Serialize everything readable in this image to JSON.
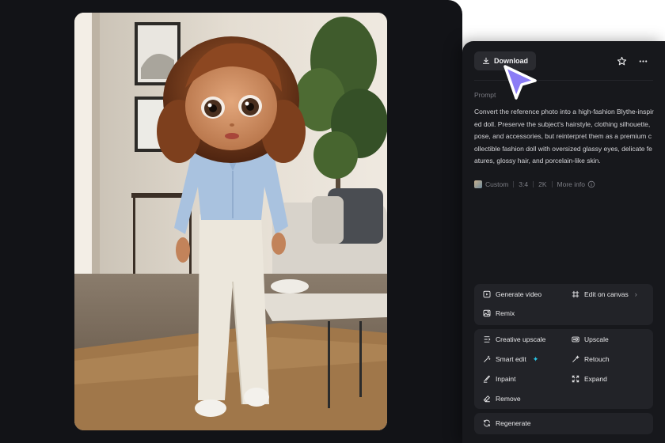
{
  "toolbar": {
    "download_label": "Download",
    "favorite_icon": "star-icon",
    "more_icon": "more-horizontal-icon"
  },
  "prompt": {
    "label": "Prompt",
    "text": "Convert the reference photo into a high-fashion Blythe-inspired doll. Preserve the subject's hairstyle, clothing silhouette, pose, and accessories, but reinterpret them as a premium collectible fashion doll with oversized glassy eyes, delicate features, glossy hair, and porcelain-like skin."
  },
  "meta": {
    "style": "Custom",
    "ratio": "3:4",
    "resolution": "2K",
    "more_info": "More info"
  },
  "actions": {
    "generate_video": "Generate video",
    "edit_on_canvas": "Edit on canvas",
    "remix": "Remix",
    "creative_upscale": "Creative upscale",
    "upscale": "Upscale",
    "smart_edit": "Smart edit",
    "retouch": "Retouch",
    "inpaint": "Inpaint",
    "expand": "Expand",
    "remove": "Remove",
    "regenerate": "Regenerate"
  },
  "colors": {
    "panel_bg": "#17181c",
    "card_bg": "#121317",
    "group_bg": "#222328",
    "cursor": "#8b7cf6",
    "sparkle": "#29c5e6"
  }
}
